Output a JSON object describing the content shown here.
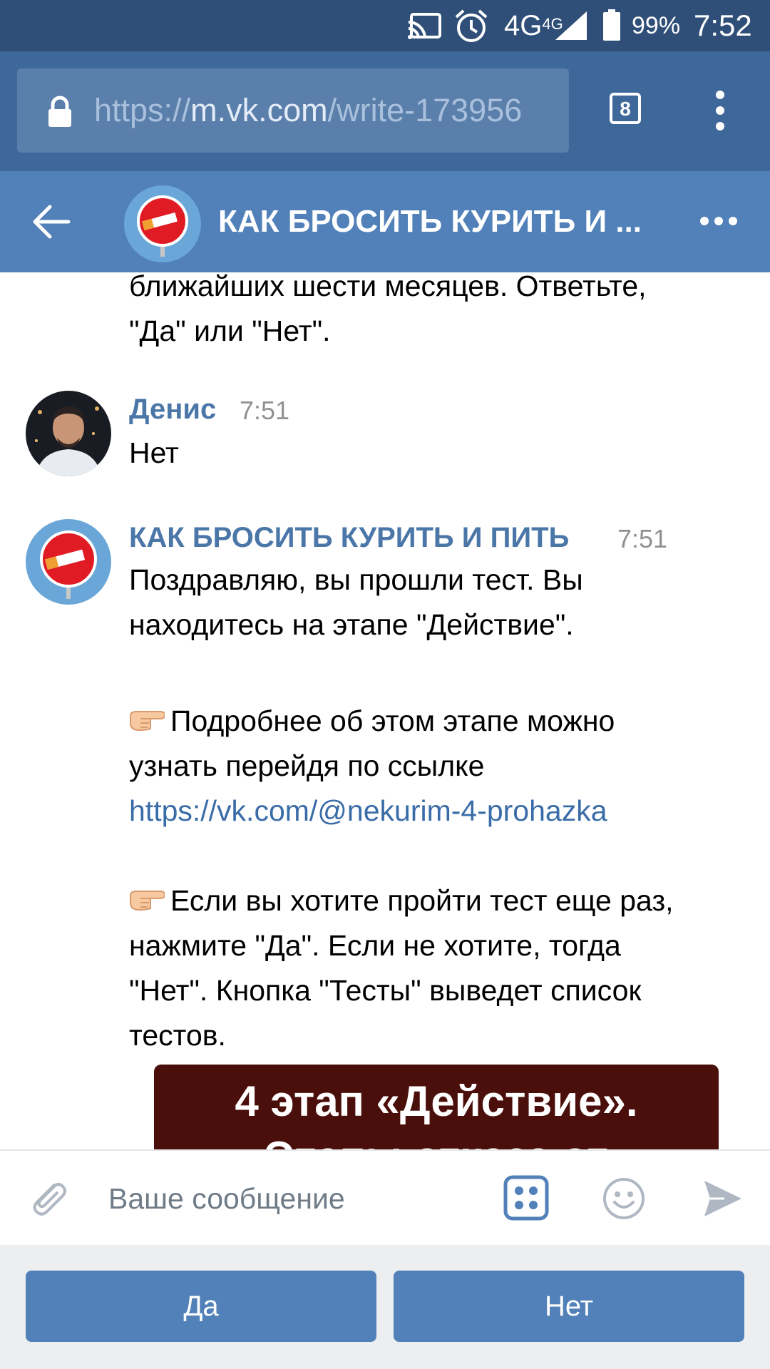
{
  "status_bar": {
    "network": "4G",
    "network_sup": "4G",
    "battery": "99%",
    "time": "7:52"
  },
  "browser": {
    "url_scheme": "https://",
    "url_host": "m.vk.com",
    "url_path": "/write-173956",
    "tab_count": "8"
  },
  "header": {
    "title": "КАК БРОСИТЬ КУРИТЬ И ..."
  },
  "messages": {
    "prev_tail": "ближайших шести месяцев. Ответьте,\n\"Да\" или \"Нет\".",
    "user_msg": {
      "author": "Денис",
      "time": "7:51",
      "text": "Нет"
    },
    "bot_msg": {
      "author": "КАК БРОСИТЬ КУРИТЬ И ПИТЬ",
      "time": "7:51",
      "para1": "Поздравляю, вы прошли тест. Вы\nнаходитесь на этапе \"Действие\".",
      "para2": "Подробнее об этом этапе можно\nузнать перейдя по ссылке",
      "link": "https://vk.com/@nekurim-4-prohazka",
      "para3": "Если вы хотите пройти тест еще раз,\nнажмите \"Да\". Если не хотите, тогда\n\"Нет\". Кнопка \"Тесты\" выведет список\nтестов."
    },
    "preview": {
      "title": "4 этап «Действие».",
      "subtitle": "Этапы отказа от"
    }
  },
  "composer": {
    "placeholder": "Ваше сообщение"
  },
  "quick_replies": {
    "yes": "Да",
    "no": "Нет"
  },
  "colors": {
    "status_bar": "#2f4f78",
    "browser_bar": "#3f689a",
    "vk_header": "#5181b8",
    "author": "#4a76a8",
    "link": "#3a6ca8",
    "button": "#5181b8",
    "preview_bg": "#4a0f0a"
  },
  "icons": {
    "cast": "cast-icon",
    "alarm": "alarm-icon",
    "signal": "signal-icon",
    "battery": "battery-icon",
    "lock": "lock-icon",
    "tabs": "tabs-icon",
    "menu": "more-vertical-icon",
    "back": "back-arrow-icon",
    "more": "more-horizontal-icon",
    "attach": "paperclip-icon",
    "keyboard": "bot-keyboard-icon",
    "smile": "smile-icon",
    "send": "send-icon",
    "pointing": "backhand-index-pointing-right-icon"
  }
}
